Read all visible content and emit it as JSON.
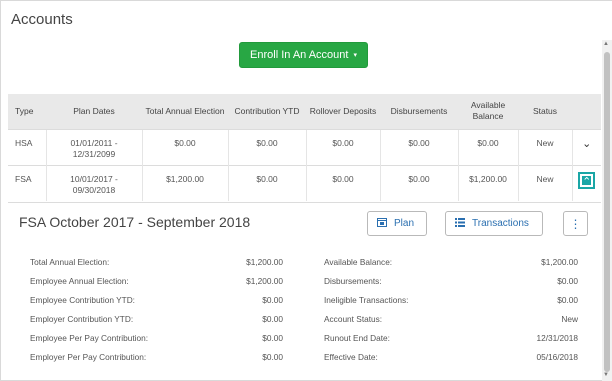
{
  "page": {
    "title": "Accounts"
  },
  "enroll_button": {
    "label": "Enroll In An Account",
    "caret": "▾"
  },
  "table": {
    "headers": [
      "Type",
      "Plan Dates",
      "Total Annual Election",
      "Contribution YTD",
      "Rollover Deposits",
      "Disbursements",
      "Available Balance",
      "Status"
    ],
    "rows": [
      {
        "type": "HSA",
        "dates": "01/01/2011 - 12/31/2099",
        "total_election": "$0.00",
        "contribution_ytd": "$0.00",
        "rollover": "$0.00",
        "disbursements": "$0.00",
        "available": "$0.00",
        "status": "New",
        "toggle": "⌄"
      },
      {
        "type": "FSA",
        "dates": "10/01/2017 - 09/30/2018",
        "total_election": "$1,200.00",
        "contribution_ytd": "$0.00",
        "rollover": "$0.00",
        "disbursements": "$0.00",
        "available": "$1,200.00",
        "status": "New",
        "toggle": "⌃"
      }
    ]
  },
  "detail": {
    "title": "FSA October 2017 - September 2018",
    "plan_label": "Plan",
    "transactions_label": "Transactions",
    "more_label": "⋮",
    "left": [
      {
        "label": "Total Annual Election:",
        "value": "$1,200.00"
      },
      {
        "label": "Employee Annual Election:",
        "value": "$1,200.00"
      },
      {
        "label": "Employee Contribution YTD:",
        "value": "$0.00"
      },
      {
        "label": "Employer Contribution YTD:",
        "value": "$0.00"
      },
      {
        "label": "Employee Per Pay Contribution:",
        "value": "$0.00"
      },
      {
        "label": "Employer Per Pay Contribution:",
        "value": "$0.00"
      }
    ],
    "right": [
      {
        "label": "Available Balance:",
        "value": "$1,200.00"
      },
      {
        "label": "Disbursements:",
        "value": "$0.00"
      },
      {
        "label": "Ineligible Transactions:",
        "value": "$0.00"
      },
      {
        "label": "Account Status:",
        "value": "New"
      },
      {
        "label": "Runout End Date:",
        "value": "12/31/2018"
      },
      {
        "label": "Effective Date:",
        "value": "05/16/2018"
      }
    ]
  },
  "colors": {
    "enroll_green": "#28a744",
    "active_teal": "#1aa6a6",
    "link_blue": "#2a6fb0"
  }
}
